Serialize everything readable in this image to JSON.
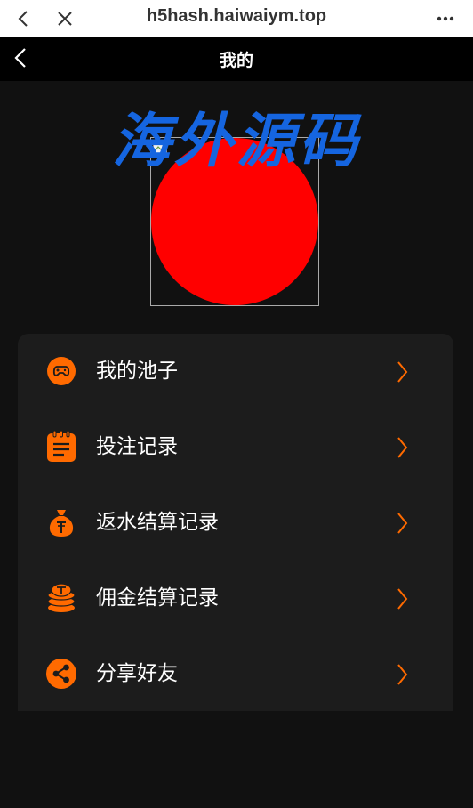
{
  "browser": {
    "url": "h5hash.haiwaiym.top"
  },
  "header": {
    "title": "我的"
  },
  "profile": {
    "watermark_text": "海外源码"
  },
  "menu": {
    "items": [
      {
        "label": "我的池子",
        "icon": "gamepad-icon"
      },
      {
        "label": "投注记录",
        "icon": "notepad-icon"
      },
      {
        "label": "返水结算记录",
        "icon": "money-bag-icon"
      },
      {
        "label": "佣金结算记录",
        "icon": "coin-stack-icon"
      },
      {
        "label": "分享好友",
        "icon": "share-icon"
      }
    ]
  },
  "colors": {
    "accent": "#ff6a00",
    "background": "#111111",
    "card": "#1c1c1c",
    "avatar": "#ff0000",
    "watermark": "#1565e0"
  }
}
